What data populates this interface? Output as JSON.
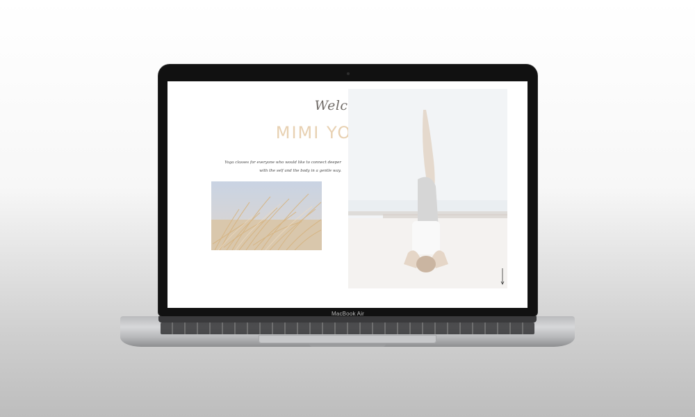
{
  "device": {
    "model_label": "MacBook Air"
  },
  "site": {
    "welcome_text": "Welcome to",
    "brand_name": "MIMI YOGA",
    "tagline_line1": "Yoga classes for everyone who would like to connect deeper",
    "tagline_line2": "with the self and the body in a gentle way."
  },
  "colors": {
    "brand": "#e8d1b2",
    "script_text": "#6f6a66",
    "body_text": "#444444"
  },
  "icons": {
    "scroll": "down-arrow-line"
  }
}
